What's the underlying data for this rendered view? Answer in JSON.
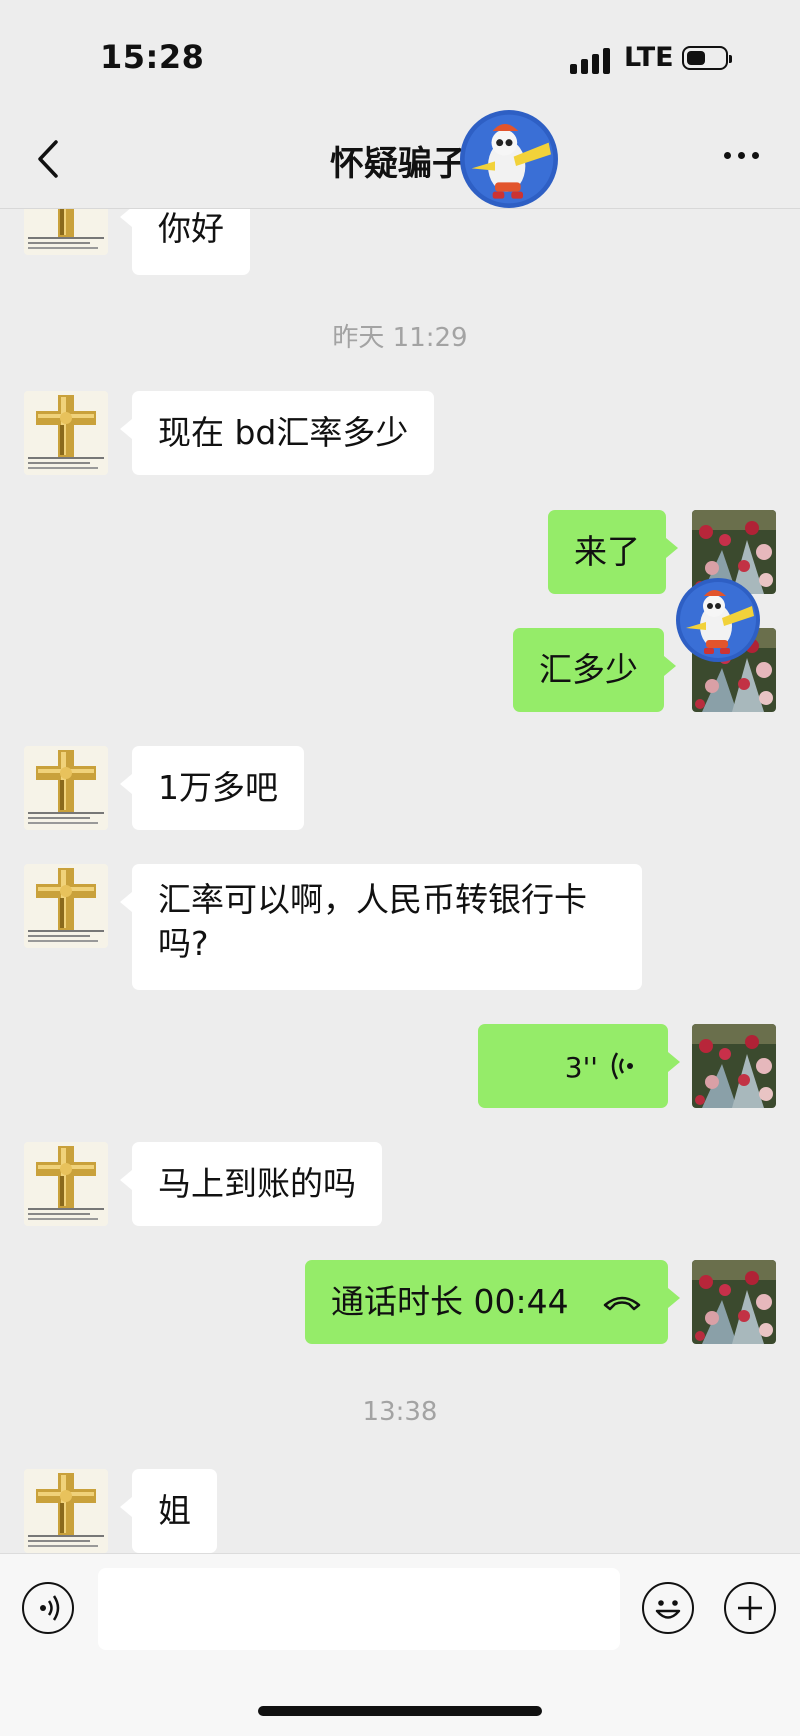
{
  "status_bar": {
    "time": "15:28",
    "network": "LTE"
  },
  "nav": {
    "title": "怀疑骗子"
  },
  "messages": [
    {
      "side": "in",
      "text": "你好"
    },
    {
      "timestamp": "昨天 11:29"
    },
    {
      "side": "in",
      "text": "现在 bd汇率多少"
    },
    {
      "side": "out",
      "text": "来了"
    },
    {
      "side": "out",
      "text": "汇多少"
    },
    {
      "side": "in",
      "text": "1万多吧"
    },
    {
      "side": "in",
      "text": "汇率可以啊，人民币转银行卡吗?"
    },
    {
      "side": "out",
      "type": "voice",
      "text": "3''"
    },
    {
      "side": "in",
      "text": "马上到账的吗"
    },
    {
      "side": "out",
      "type": "call",
      "text": "通话时长 00:44"
    },
    {
      "timestamp": "13:38"
    },
    {
      "side": "in",
      "text": "姐"
    }
  ],
  "input": {
    "value": "",
    "placeholder": ""
  },
  "icons": {
    "back": "chevron-left-icon",
    "more": "more-dots-icon",
    "voice": "voice-toggle-icon",
    "emoji": "emoji-icon",
    "plus": "plus-icon",
    "voice_message": "voice-wave-icon",
    "call": "phone-hangup-icon"
  },
  "colors": {
    "background": "#ededed",
    "outgoing_bubble": "#95ec69",
    "incoming_bubble": "#ffffff",
    "timestamp": "#a3a3a3"
  }
}
